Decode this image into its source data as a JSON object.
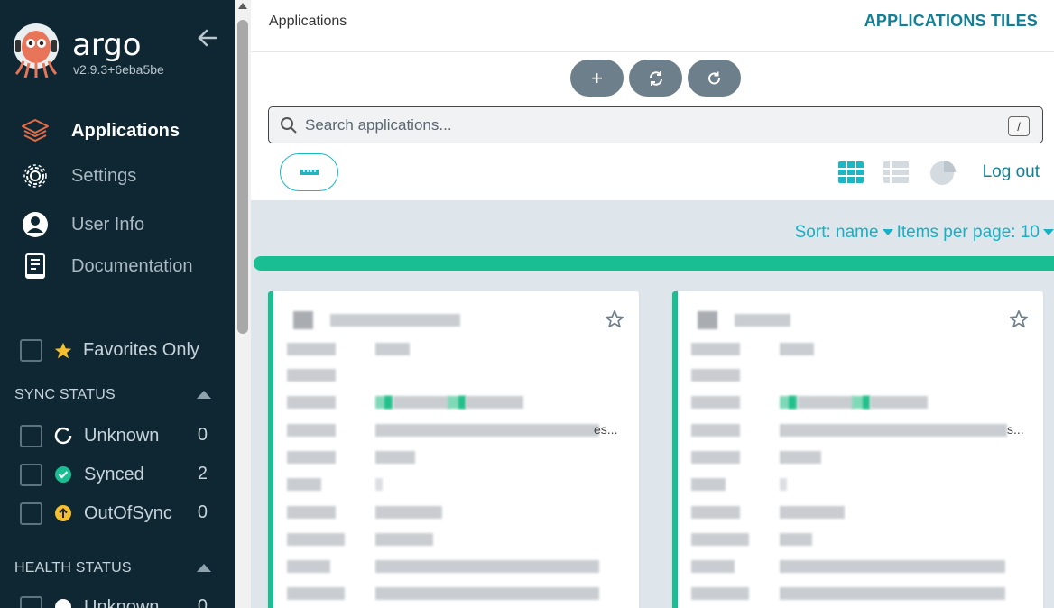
{
  "sidebar": {
    "brand": "argo",
    "version": "v2.9.3+6eba5be",
    "nav": [
      {
        "label": "Applications",
        "icon": "layers-icon",
        "active": true
      },
      {
        "label": "Settings",
        "icon": "gear-icon",
        "active": false
      },
      {
        "label": "User Info",
        "icon": "user-icon",
        "active": false
      },
      {
        "label": "Documentation",
        "icon": "book-icon",
        "active": false
      }
    ],
    "favorites_label": "Favorites Only",
    "sync_status": {
      "title": "SYNC STATUS",
      "items": [
        {
          "label": "Unknown",
          "count": "0"
        },
        {
          "label": "Synced",
          "count": "2"
        },
        {
          "label": "OutOfSync",
          "count": "0"
        }
      ]
    },
    "health_status": {
      "title": "HEALTH STATUS",
      "items": [
        {
          "label": "Unknown",
          "count": "0"
        }
      ]
    }
  },
  "header": {
    "breadcrumb": "Applications",
    "title": "APPLICATIONS TILES",
    "actions": {
      "add": "+",
      "sync": "sync-icon",
      "refresh": "refresh-icon"
    },
    "search_placeholder": "Search applications...",
    "search_shortcut": "/",
    "logout": "Log out"
  },
  "toolbar": {
    "sort_label": "Sort: name",
    "per_page_label": "Items per page: 10"
  },
  "cards": [
    {
      "trail_ellipsis": "es..."
    },
    {
      "trail_ellipsis": "s..."
    }
  ],
  "colors": {
    "sidebar_bg": "#0f2733",
    "accent": "#127f96",
    "synced": "#1abe93",
    "out_of_sync": "#f4c030",
    "content_bg": "#dee6eb"
  }
}
